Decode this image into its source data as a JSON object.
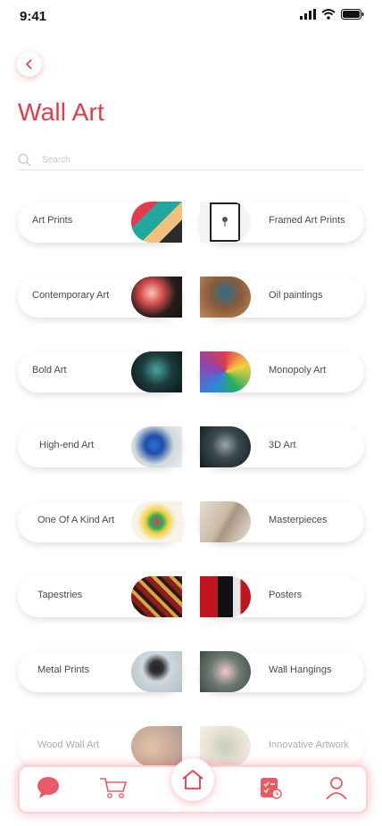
{
  "status": {
    "time": "9:41"
  },
  "header": {
    "title": "Wall Art"
  },
  "search": {
    "placeholder": "Search"
  },
  "categories": [
    {
      "label": "Art Prints"
    },
    {
      "label": "Framed Art Prints"
    },
    {
      "label": "Contemporary Art"
    },
    {
      "label": "Oil paintings"
    },
    {
      "label": "Bold Art"
    },
    {
      "label": "Monopoly Art"
    },
    {
      "label": "High-end Art"
    },
    {
      "label": "3D Art"
    },
    {
      "label": "One Of A Kind Art"
    },
    {
      "label": "Masterpieces"
    },
    {
      "label": "Tapestries"
    },
    {
      "label": "Posters"
    },
    {
      "label": "Metal Prints"
    },
    {
      "label": "Wall Hangings"
    },
    {
      "label": "Wood Wall Art"
    },
    {
      "label": "Innovative Artwork"
    }
  ],
  "colors": {
    "accent": "#e23b4c",
    "nav_glow": "#ffd2d6"
  },
  "nav": {
    "items": [
      {
        "icon": "chat-icon"
      },
      {
        "icon": "cart-icon"
      },
      {
        "icon": "home-icon"
      },
      {
        "icon": "orders-icon"
      },
      {
        "icon": "profile-icon"
      }
    ]
  }
}
